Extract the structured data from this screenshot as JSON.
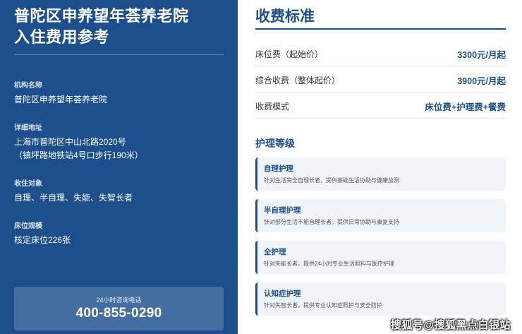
{
  "left": {
    "title_line1": "普陀区申养望年荟养老院",
    "title_line2": "入住费用参考",
    "info": [
      {
        "label": "机构名称",
        "value_lines": [
          "普陀区申养望年荟养老院"
        ]
      },
      {
        "label": "详细地址",
        "value_lines": [
          "上海市普陀区中山北路2020号",
          "（镇坪路地铁站4号口步行190米）"
        ]
      },
      {
        "label": "收住对象",
        "value_lines": [
          "自理、半自理、失能、失智长者"
        ]
      },
      {
        "label": "床位规模",
        "value_lines": [
          "核定床位226张"
        ]
      }
    ],
    "phone": {
      "label": "24小时咨询电话",
      "number": "400-855-0290"
    }
  },
  "right": {
    "title": "收费标准",
    "fees": [
      {
        "label": "床位费（起始价）",
        "value": "3300元/月起"
      },
      {
        "label": "综合收费（整体起价）",
        "value": "3900元/月起"
      },
      {
        "label": "收费模式",
        "value": "床位费+护理费+餐费"
      }
    ],
    "care_title": "护理等级",
    "care_levels": [
      {
        "name": "自理护理",
        "desc": "针对生活完全自理长者，提供基础生活协助与健康监测"
      },
      {
        "name": "半自理护理",
        "desc": "针对部分生活不能自理长者，提供日常协助与康复支持"
      },
      {
        "name": "全护理",
        "desc": "针对失能长者，提供24小时专业生活照料与医疗护理"
      },
      {
        "name": "认知症护理",
        "desc": "针对失智长者，提供专业认知症照护与安全防护"
      }
    ]
  },
  "watermark": "搜狐号@搜狐黑点白银站",
  "colors": {
    "primary": "#1d4f8c",
    "card_bg": "#f1f5fa",
    "text": "#333333"
  }
}
